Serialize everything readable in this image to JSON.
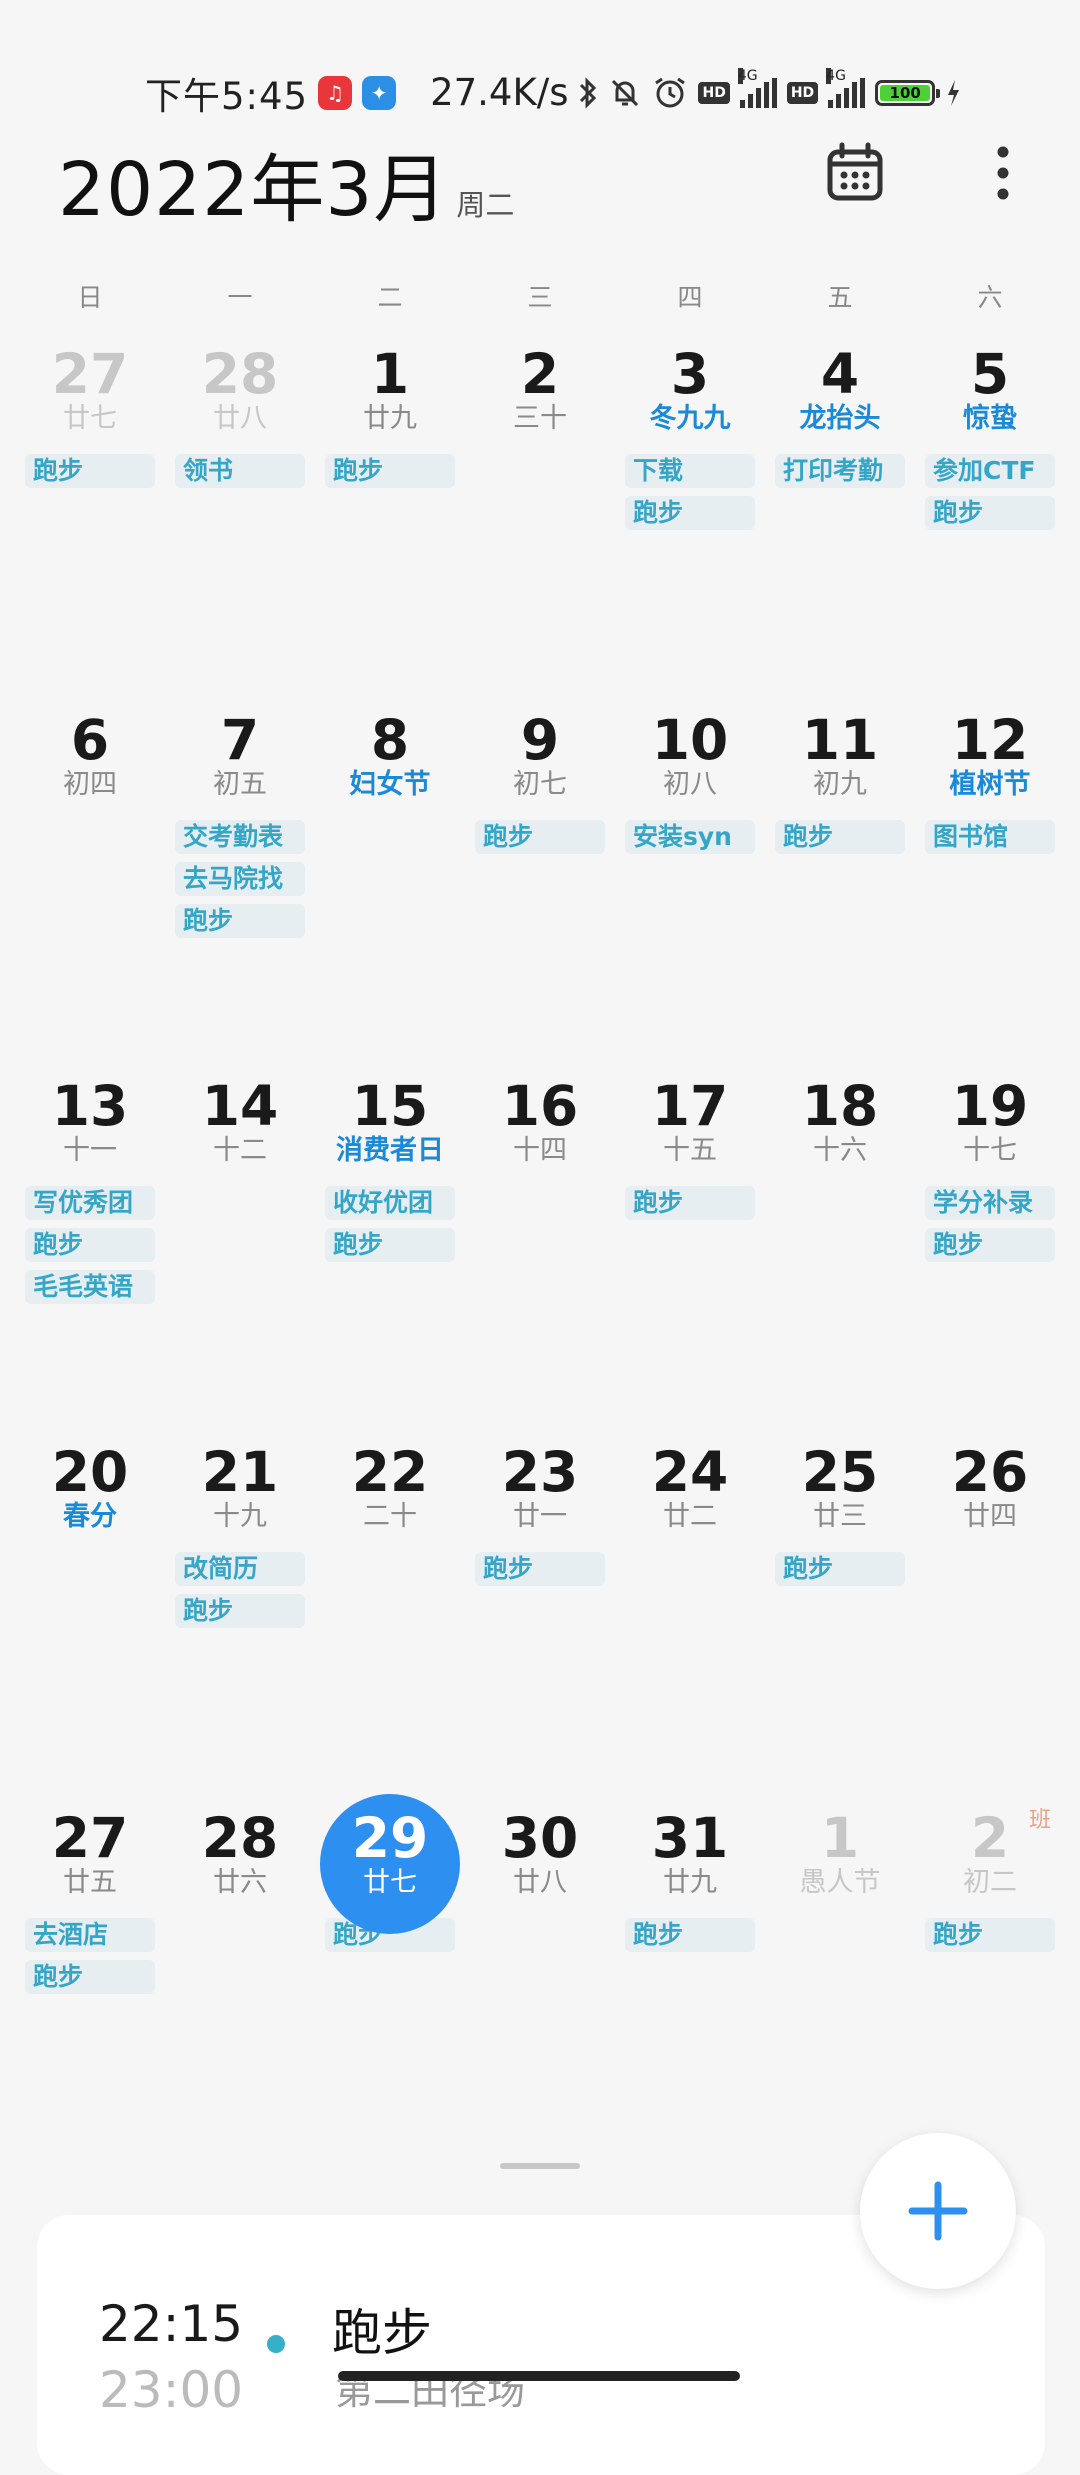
{
  "status_bar": {
    "time": "下午5:45",
    "net_speed": "27.4K/s",
    "battery": "100",
    "signal_type": "4G",
    "hd": "HD"
  },
  "header": {
    "title": "2022年3月",
    "weekday": "周二"
  },
  "weekdays": [
    "日",
    "一",
    "二",
    "三",
    "四",
    "五",
    "六"
  ],
  "weeks": [
    {
      "days": [
        {
          "num": "27",
          "lunar": "廿七",
          "events": [
            "跑步"
          ]
        },
        {
          "num": "28",
          "lunar": "廿八",
          "events": [
            "领书"
          ]
        },
        {
          "num": "1",
          "lunar": "廿九",
          "events": [
            "跑步"
          ]
        },
        {
          "num": "2",
          "lunar": "三十",
          "events": []
        },
        {
          "num": "3",
          "lunar": "冬九九",
          "events": [
            "下载",
            "跑步"
          ]
        },
        {
          "num": "4",
          "lunar": "龙抬头",
          "events": [
            "打印考勤"
          ]
        },
        {
          "num": "5",
          "lunar": "惊蛰",
          "events": [
            "参加CTF",
            "跑步"
          ]
        }
      ]
    },
    {
      "days": [
        {
          "num": "6",
          "lunar": "初四",
          "events": []
        },
        {
          "num": "7",
          "lunar": "初五",
          "events": [
            "交考勤表",
            "去马院找",
            "跑步"
          ]
        },
        {
          "num": "8",
          "lunar": "妇女节",
          "events": []
        },
        {
          "num": "9",
          "lunar": "初七",
          "events": [
            "跑步"
          ]
        },
        {
          "num": "10",
          "lunar": "初八",
          "events": [
            "安装syn"
          ]
        },
        {
          "num": "11",
          "lunar": "初九",
          "events": [
            "跑步"
          ]
        },
        {
          "num": "12",
          "lunar": "植树节",
          "events": [
            "图书馆"
          ]
        }
      ]
    },
    {
      "days": [
        {
          "num": "13",
          "lunar": "十一",
          "events": [
            "写优秀团",
            "跑步",
            "毛毛英语"
          ]
        },
        {
          "num": "14",
          "lunar": "十二",
          "events": []
        },
        {
          "num": "15",
          "lunar": "消费者日",
          "events": [
            "收好优团",
            "跑步"
          ]
        },
        {
          "num": "16",
          "lunar": "十四",
          "events": []
        },
        {
          "num": "17",
          "lunar": "十五",
          "events": [
            "跑步"
          ]
        },
        {
          "num": "18",
          "lunar": "十六",
          "events": []
        },
        {
          "num": "19",
          "lunar": "十七",
          "events": [
            "学分补录",
            "跑步"
          ]
        }
      ]
    },
    {
      "days": [
        {
          "num": "20",
          "lunar": "春分",
          "events": []
        },
        {
          "num": "21",
          "lunar": "十九",
          "events": [
            "改简历",
            "跑步"
          ]
        },
        {
          "num": "22",
          "lunar": "二十",
          "events": []
        },
        {
          "num": "23",
          "lunar": "廿一",
          "events": [
            "跑步"
          ]
        },
        {
          "num": "24",
          "lunar": "廿二",
          "events": []
        },
        {
          "num": "25",
          "lunar": "廿三",
          "events": [
            "跑步"
          ]
        },
        {
          "num": "26",
          "lunar": "廿四",
          "events": []
        }
      ]
    },
    {
      "days": [
        {
          "num": "27",
          "lunar": "廿五",
          "events": [
            "去酒店",
            "跑步"
          ]
        },
        {
          "num": "28",
          "lunar": "廿六",
          "events": []
        },
        {
          "num": "29",
          "lunar": "廿七",
          "events": [
            "跑步"
          ]
        },
        {
          "num": "30",
          "lunar": "廿八",
          "events": []
        },
        {
          "num": "31",
          "lunar": "廿九",
          "events": [
            "跑步"
          ]
        },
        {
          "num": "1",
          "lunar": "愚人节",
          "events": []
        },
        {
          "num": "2",
          "lunar": "初二",
          "badge": "班",
          "events": [
            "跑步"
          ]
        }
      ]
    }
  ],
  "agenda": {
    "start": "22:15",
    "end": "23:00",
    "title": "跑步",
    "location": "第二田径场"
  },
  "colors": {
    "accent": "#2d8ff0",
    "festival": "#1a8ad8",
    "event_text": "#36a6c8",
    "event_bg": "#e6eef1"
  }
}
